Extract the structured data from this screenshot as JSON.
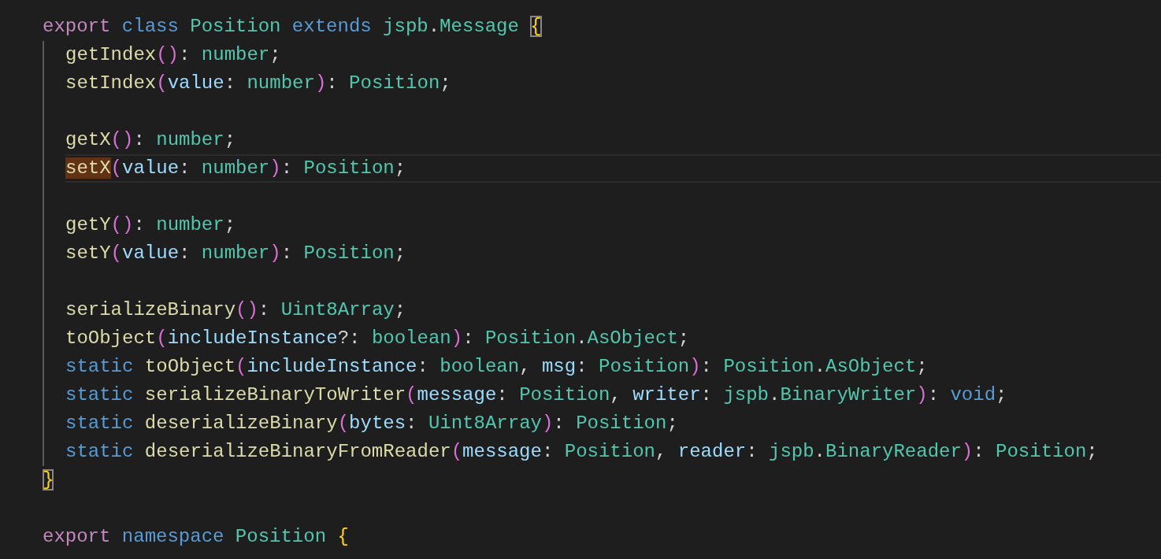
{
  "editor": {
    "lines": [
      {
        "kind": "code",
        "tokens": [
          {
            "text": "export",
            "kind": "keyword"
          },
          {
            "text": " class",
            "kind": "storage"
          },
          {
            "text": " Position",
            "kind": "type"
          },
          {
            "text": " extends",
            "kind": "storage"
          },
          {
            "text": " jspb",
            "kind": "type"
          },
          {
            "text": ".",
            "kind": "plain"
          },
          {
            "text": "Message",
            "kind": "type"
          },
          {
            "text": " {",
            "kind": "brace",
            "bracket_match": true
          }
        ],
        "children": [
          {
            "kind": "code",
            "tokens": [
              {
                "text": "getIndex",
                "kind": "func"
              },
              {
                "text": "()",
                "kind": "paren"
              },
              {
                "text": ": ",
                "kind": "plain"
              },
              {
                "text": "number",
                "kind": "type"
              },
              {
                "text": ";",
                "kind": "plain"
              }
            ]
          },
          {
            "kind": "code",
            "tokens": [
              {
                "text": "setIndex",
                "kind": "func"
              },
              {
                "text": "(",
                "kind": "paren"
              },
              {
                "text": "value",
                "kind": "param"
              },
              {
                "text": ": ",
                "kind": "plain"
              },
              {
                "text": "number",
                "kind": "type"
              },
              {
                "text": ")",
                "kind": "paren"
              },
              {
                "text": ": ",
                "kind": "plain"
              },
              {
                "text": "Position",
                "kind": "type"
              },
              {
                "text": ";",
                "kind": "plain"
              }
            ]
          },
          {
            "kind": "blank"
          },
          {
            "kind": "code",
            "tokens": [
              {
                "text": "getX",
                "kind": "func"
              },
              {
                "text": "()",
                "kind": "paren"
              },
              {
                "text": ": ",
                "kind": "plain"
              },
              {
                "text": "number",
                "kind": "type"
              },
              {
                "text": ";",
                "kind": "plain"
              }
            ]
          },
          {
            "kind": "code",
            "current": true,
            "tokens": [
              {
                "text": "setX",
                "kind": "func",
                "highlighted": true
              },
              {
                "text": "(",
                "kind": "paren"
              },
              {
                "text": "value",
                "kind": "param"
              },
              {
                "text": ": ",
                "kind": "plain"
              },
              {
                "text": "number",
                "kind": "type"
              },
              {
                "text": ")",
                "kind": "paren"
              },
              {
                "text": ": ",
                "kind": "plain"
              },
              {
                "text": "Position",
                "kind": "type"
              },
              {
                "text": ";",
                "kind": "plain"
              }
            ]
          },
          {
            "kind": "blank"
          },
          {
            "kind": "code",
            "tokens": [
              {
                "text": "getY",
                "kind": "func"
              },
              {
                "text": "()",
                "kind": "paren"
              },
              {
                "text": ": ",
                "kind": "plain"
              },
              {
                "text": "number",
                "kind": "type"
              },
              {
                "text": ";",
                "kind": "plain"
              }
            ]
          },
          {
            "kind": "code",
            "tokens": [
              {
                "text": "setY",
                "kind": "func"
              },
              {
                "text": "(",
                "kind": "paren"
              },
              {
                "text": "value",
                "kind": "param"
              },
              {
                "text": ": ",
                "kind": "plain"
              },
              {
                "text": "number",
                "kind": "type"
              },
              {
                "text": ")",
                "kind": "paren"
              },
              {
                "text": ": ",
                "kind": "plain"
              },
              {
                "text": "Position",
                "kind": "type"
              },
              {
                "text": ";",
                "kind": "plain"
              }
            ]
          },
          {
            "kind": "blank"
          },
          {
            "kind": "code",
            "tokens": [
              {
                "text": "serializeBinary",
                "kind": "func"
              },
              {
                "text": "()",
                "kind": "paren"
              },
              {
                "text": ": ",
                "kind": "plain"
              },
              {
                "text": "Uint8Array",
                "kind": "type"
              },
              {
                "text": ";",
                "kind": "plain"
              }
            ]
          },
          {
            "kind": "code",
            "tokens": [
              {
                "text": "toObject",
                "kind": "func"
              },
              {
                "text": "(",
                "kind": "paren"
              },
              {
                "text": "includeInstance",
                "kind": "param"
              },
              {
                "text": "?: ",
                "kind": "plain"
              },
              {
                "text": "boolean",
                "kind": "type"
              },
              {
                "text": ")",
                "kind": "paren"
              },
              {
                "text": ": ",
                "kind": "plain"
              },
              {
                "text": "Position",
                "kind": "type"
              },
              {
                "text": ".",
                "kind": "plain"
              },
              {
                "text": "AsObject",
                "kind": "type"
              },
              {
                "text": ";",
                "kind": "plain"
              }
            ]
          },
          {
            "kind": "code",
            "tokens": [
              {
                "text": "static",
                "kind": "storage"
              },
              {
                "text": " toObject",
                "kind": "func"
              },
              {
                "text": "(",
                "kind": "paren"
              },
              {
                "text": "includeInstance",
                "kind": "param"
              },
              {
                "text": ": ",
                "kind": "plain"
              },
              {
                "text": "boolean",
                "kind": "type"
              },
              {
                "text": ", ",
                "kind": "plain"
              },
              {
                "text": "msg",
                "kind": "param"
              },
              {
                "text": ": ",
                "kind": "plain"
              },
              {
                "text": "Position",
                "kind": "type"
              },
              {
                "text": ")",
                "kind": "paren"
              },
              {
                "text": ": ",
                "kind": "plain"
              },
              {
                "text": "Position",
                "kind": "type"
              },
              {
                "text": ".",
                "kind": "plain"
              },
              {
                "text": "AsObject",
                "kind": "type"
              },
              {
                "text": ";",
                "kind": "plain"
              }
            ]
          },
          {
            "kind": "code",
            "tokens": [
              {
                "text": "static",
                "kind": "storage"
              },
              {
                "text": " serializeBinaryToWriter",
                "kind": "func"
              },
              {
                "text": "(",
                "kind": "paren"
              },
              {
                "text": "message",
                "kind": "param"
              },
              {
                "text": ": ",
                "kind": "plain"
              },
              {
                "text": "Position",
                "kind": "type"
              },
              {
                "text": ", ",
                "kind": "plain"
              },
              {
                "text": "writer",
                "kind": "param"
              },
              {
                "text": ": ",
                "kind": "plain"
              },
              {
                "text": "jspb",
                "kind": "type"
              },
              {
                "text": ".",
                "kind": "plain"
              },
              {
                "text": "BinaryWriter",
                "kind": "type"
              },
              {
                "text": ")",
                "kind": "paren"
              },
              {
                "text": ": ",
                "kind": "plain"
              },
              {
                "text": "void",
                "kind": "storage"
              },
              {
                "text": ";",
                "kind": "plain"
              }
            ]
          },
          {
            "kind": "code",
            "tokens": [
              {
                "text": "static",
                "kind": "storage"
              },
              {
                "text": " deserializeBinary",
                "kind": "func"
              },
              {
                "text": "(",
                "kind": "paren"
              },
              {
                "text": "bytes",
                "kind": "param"
              },
              {
                "text": ": ",
                "kind": "plain"
              },
              {
                "text": "Uint8Array",
                "kind": "type"
              },
              {
                "text": ")",
                "kind": "paren"
              },
              {
                "text": ": ",
                "kind": "plain"
              },
              {
                "text": "Position",
                "kind": "type"
              },
              {
                "text": ";",
                "kind": "plain"
              }
            ]
          },
          {
            "kind": "code",
            "tokens": [
              {
                "text": "static",
                "kind": "storage"
              },
              {
                "text": " deserializeBinaryFromReader",
                "kind": "func"
              },
              {
                "text": "(",
                "kind": "paren"
              },
              {
                "text": "message",
                "kind": "param"
              },
              {
                "text": ": ",
                "kind": "plain"
              },
              {
                "text": "Position",
                "kind": "type"
              },
              {
                "text": ", ",
                "kind": "plain"
              },
              {
                "text": "reader",
                "kind": "param"
              },
              {
                "text": ": ",
                "kind": "plain"
              },
              {
                "text": "jspb",
                "kind": "type"
              },
              {
                "text": ".",
                "kind": "plain"
              },
              {
                "text": "BinaryReader",
                "kind": "type"
              },
              {
                "text": ")",
                "kind": "paren"
              },
              {
                "text": ": ",
                "kind": "plain"
              },
              {
                "text": "Position",
                "kind": "type"
              },
              {
                "text": ";",
                "kind": "plain"
              }
            ]
          }
        ]
      },
      {
        "kind": "code",
        "tokens": [
          {
            "text": "}",
            "kind": "brace",
            "bracket_match": true
          }
        ]
      },
      {
        "kind": "blank"
      },
      {
        "kind": "code",
        "tokens": [
          {
            "text": "export",
            "kind": "keyword"
          },
          {
            "text": " namespace",
            "kind": "storage"
          },
          {
            "text": " Position",
            "kind": "type"
          },
          {
            "text": " {",
            "kind": "brace"
          }
        ]
      }
    ]
  }
}
